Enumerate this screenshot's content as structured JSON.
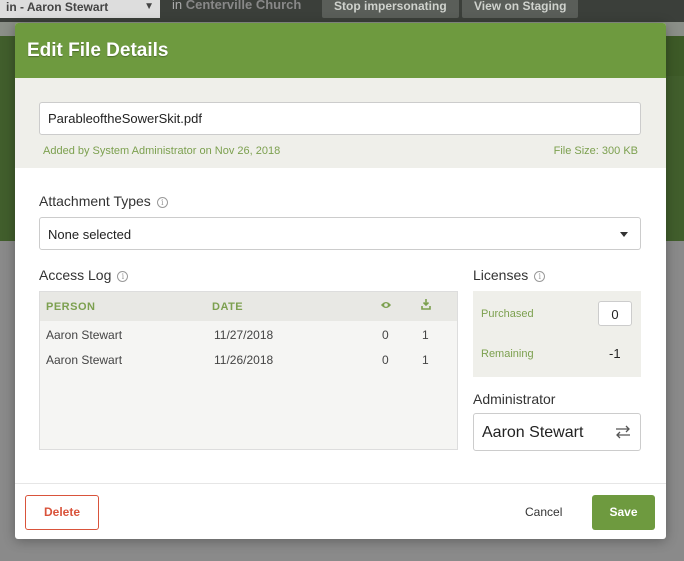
{
  "background": {
    "user_select": "in - Aaron Stewart",
    "church_prefix": "in",
    "church_name": "Centerville Church",
    "stop_button": "Stop impersonating",
    "staging_button": "View on Staging"
  },
  "modal": {
    "title": "Edit File Details",
    "file_name": "ParableoftheSowerSkit.pdf",
    "added_by": "Added by System Administrator on Nov 26, 2018",
    "file_size": "File Size: 300 KB",
    "attachment_types_label": "Attachment Types",
    "attachment_types_value": "None selected",
    "access_log_label": "Access Log",
    "access_log": {
      "columns": [
        "PERSON",
        "DATE"
      ],
      "view_icon": "eye-icon",
      "download_icon": "download-icon",
      "rows": [
        {
          "person": "Aaron Stewart",
          "date": "11/27/2018",
          "views": "0",
          "downloads": "1"
        },
        {
          "person": "Aaron Stewart",
          "date": "11/26/2018",
          "views": "0",
          "downloads": "1"
        }
      ]
    },
    "licenses_label": "Licenses",
    "purchased_label": "Purchased",
    "purchased_value": "0",
    "remaining_label": "Remaining",
    "remaining_value": "-1",
    "administrator_label": "Administrator",
    "administrator_value": "Aaron Stewart",
    "delete_button": "Delete",
    "cancel_button": "Cancel",
    "save_button": "Save"
  },
  "colors": {
    "accent": "#6e9a3f",
    "danger": "#d9533b"
  }
}
